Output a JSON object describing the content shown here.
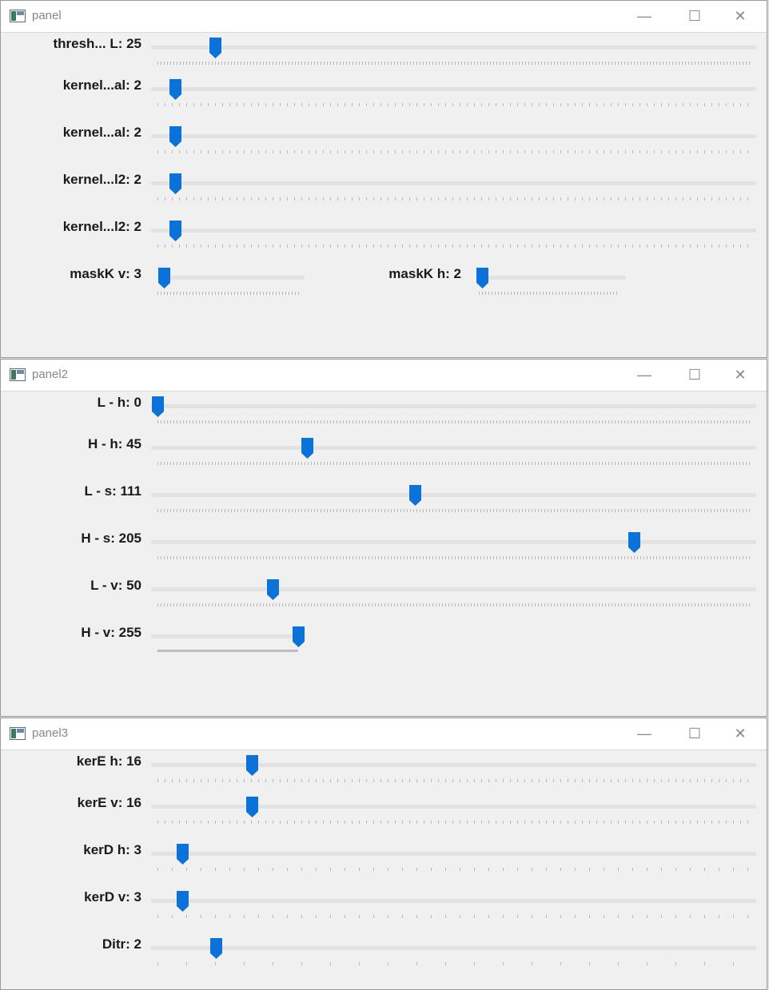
{
  "windows": [
    {
      "title": "panel",
      "controls": {
        "minimize": "—",
        "maximize": "☐",
        "close": "✕"
      },
      "trackbars": [
        {
          "label": "thresh... L: 25",
          "value": 25
        },
        {
          "label": "kernel...al: 2",
          "value": 2
        },
        {
          "label": "kernel...al: 2",
          "value": 2
        },
        {
          "label": "kernel...l2: 2",
          "value": 2
        },
        {
          "label": "kernel...l2: 2",
          "value": 2
        },
        {
          "label": "maskK v: 3",
          "value": 3
        },
        {
          "label": "maskK h: 2",
          "value": 2
        }
      ]
    },
    {
      "title": "panel2",
      "controls": {
        "minimize": "—",
        "maximize": "☐",
        "close": "✕"
      },
      "trackbars": [
        {
          "label": "L - h: 0",
          "value": 0
        },
        {
          "label": "H - h: 45",
          "value": 45
        },
        {
          "label": "L - s: 111",
          "value": 111
        },
        {
          "label": "H - s: 205",
          "value": 205
        },
        {
          "label": "L - v: 50",
          "value": 50
        },
        {
          "label": "H - v: 255",
          "value": 255
        }
      ]
    },
    {
      "title": "panel3",
      "controls": {
        "minimize": "—",
        "maximize": "☐",
        "close": "✕"
      },
      "trackbars": [
        {
          "label": "kerE h: 16",
          "value": 16
        },
        {
          "label": "kerE v: 16",
          "value": 16
        },
        {
          "label": "kerD h: 3",
          "value": 3
        },
        {
          "label": "kerD v: 3",
          "value": 3
        },
        {
          "label": "Ditr: 2",
          "value": 2
        }
      ]
    }
  ],
  "colors": {
    "thumb": "#0a72d8",
    "window_bg": "#f0f0f0",
    "titlebar_bg": "#ffffff"
  },
  "icons": {
    "window": "app-window-icon",
    "minimize": "minimize-icon",
    "maximize": "maximize-icon",
    "close": "close-icon"
  }
}
